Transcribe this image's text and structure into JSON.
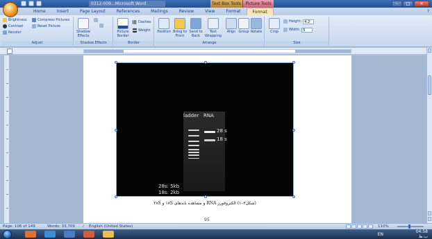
{
  "window": {
    "title": "0312-009...Microsoft Word",
    "contextual_tab_1": "Text Box Tools",
    "contextual_tab_2": "Picture Tools",
    "minimize": "–",
    "restore": "□",
    "close": "✕"
  },
  "tabs": [
    "Home",
    "Insert",
    "Page Layout",
    "References",
    "Mailings",
    "Review",
    "View",
    "Format",
    "Format"
  ],
  "active_tab_index": 8,
  "help": "?",
  "ribbon": {
    "adjust": {
      "brightness": "Brightness",
      "contrast": "Contrast",
      "recolor": "Recolor",
      "compress": "Compress Pictures",
      "reset": "Reset Picture",
      "label": "Adjust"
    },
    "shadow_effects": {
      "shadow": "Shadow Effects",
      "label": "Shadow Effects"
    },
    "border": {
      "picture_border": "Picture Border",
      "dashes": "Dashes",
      "weight": "Weight",
      "label": "Border"
    },
    "arrange": {
      "position": "Position",
      "bring_to_front": "Bring to Front",
      "send_to_back": "Send to Back",
      "text_wrapping": "Text Wrapping",
      "align": "Align",
      "group": "Group",
      "rotate": "Rotate",
      "label": "Arrange"
    },
    "size": {
      "crop": "Crop",
      "height_label": "Height:",
      "height_value": "4.2",
      "width_label": "Width:",
      "width_value": "5",
      "label": "Size"
    }
  },
  "document": {
    "gel": {
      "ladder": "ladder",
      "rna": "RNA",
      "band_28s": "28 s",
      "band_18s": "18 s",
      "note_1": "28s: 5kb",
      "note_2": "18s: 2kb"
    },
    "caption": "(شکل۳–۱) الکتروفورز RNA و مشاهده باندهای ۱۸S و ۲۸S",
    "page_number": "95"
  },
  "status": {
    "page": "Page: 106 of 149",
    "words": "Words: 33,709",
    "language": "English (United States)",
    "zoom": "110%"
  },
  "taskbar": {
    "language": "EN",
    "time": "04:58",
    "period": "ب.ظ"
  },
  "colors": {
    "ribbon_bg": "#c8d8ee",
    "active_tab": "#f6e6b9",
    "text_box_tools": "#b08437",
    "picture_tools": "#c26479"
  }
}
